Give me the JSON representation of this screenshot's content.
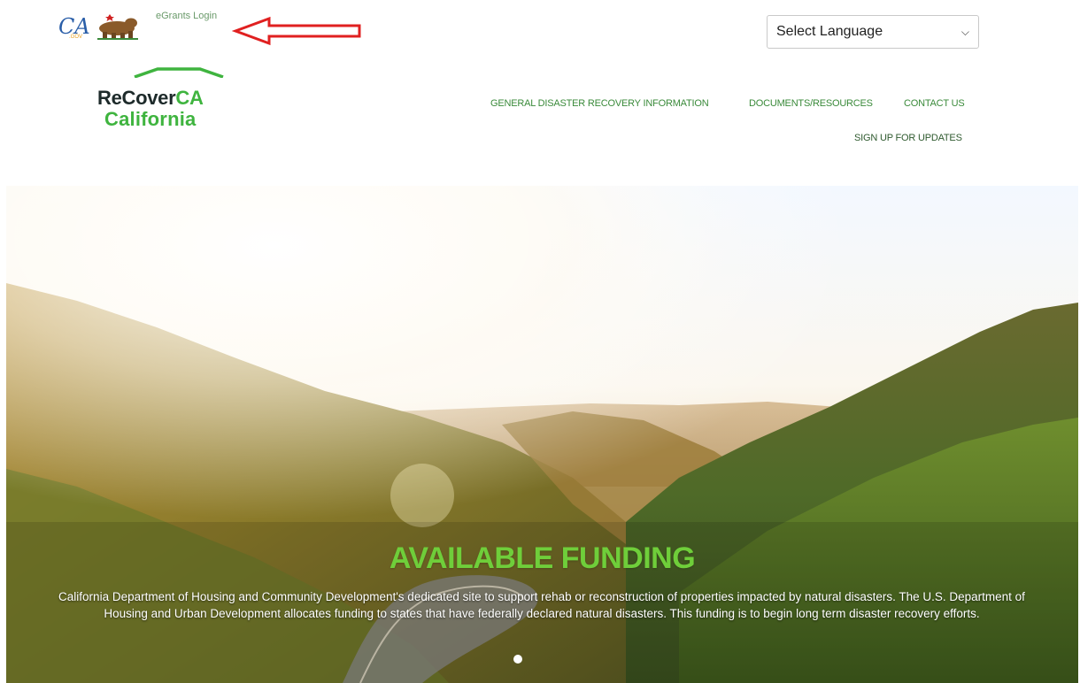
{
  "header": {
    "egrants_link": "eGrants Login",
    "language_select": {
      "value": "Select Language"
    }
  },
  "brand": {
    "line1_part1": "ReCover",
    "line1_part2": "CA",
    "line2": "California"
  },
  "nav": {
    "items": [
      {
        "label": "GENERAL DISASTER RECOVERY INFORMATION"
      },
      {
        "label": "DOCUMENTS/RESOURCES"
      },
      {
        "label": "CONTACT US"
      },
      {
        "label": "SIGN UP FOR UPDATES"
      }
    ]
  },
  "hero": {
    "title": "AVAILABLE FUNDING",
    "description": "California Department of Housing and Community Development's dedicated site to support rehab or reconstruction of properties impacted by natural disasters. The U.S. Department of Housing and Urban Development allocates funding to states that have federally declared natural disasters. This funding is to begin long term disaster recovery efforts.",
    "slides_total": 1,
    "active_slide": 1
  },
  "colors": {
    "brand_green": "#3fb43f",
    "nav_green": "#3a8a3a",
    "hero_title": "#6fce3a",
    "annotation_red": "#e02020"
  }
}
